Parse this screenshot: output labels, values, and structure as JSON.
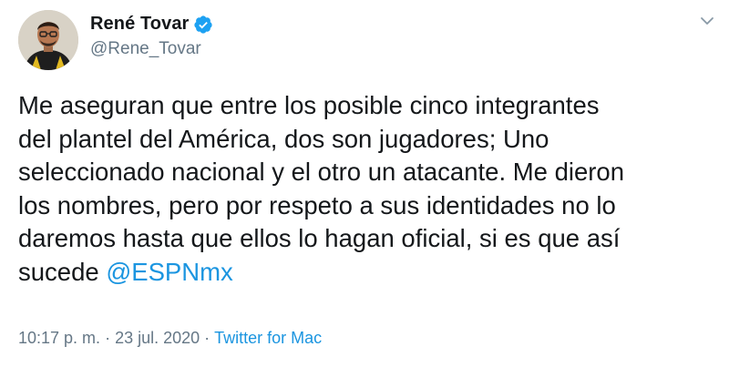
{
  "tweet": {
    "display_name": "René Tovar",
    "handle": "@Rene_Tovar",
    "verified": true,
    "body_text": "Me aseguran que entre los posible cinco integrantes\ndel plantel del América, dos son jugadores; Uno\nseleccionado nacional y el otro un atacante. Me dieron\nlos nombres, pero por respeto a sus identidades no lo\ndaremos hasta que ellos lo hagan oficial, si es que así\nsucede ",
    "mention": "@ESPNmx",
    "time": "10:17 p. m.",
    "separator": "·",
    "date": "23 jul. 2020",
    "source": "Twitter for Mac"
  },
  "icons": {
    "verified": "verified-badge-icon",
    "menu": "chevron-down-icon"
  },
  "colors": {
    "link": "#1b95e0",
    "verified": "#1da1f2",
    "text": "#14171a",
    "muted": "#657786"
  }
}
